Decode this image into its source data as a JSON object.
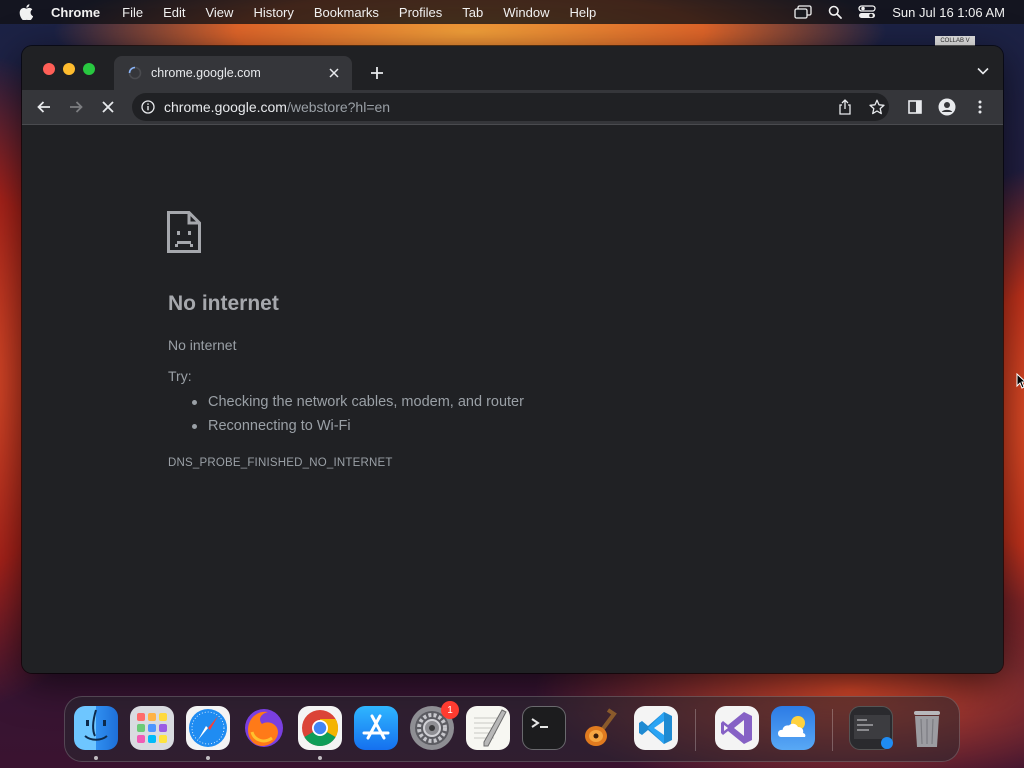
{
  "menubar": {
    "app_name": "Chrome",
    "items": [
      "File",
      "Edit",
      "View",
      "History",
      "Bookmarks",
      "Profiles",
      "Tab",
      "Window",
      "Help"
    ],
    "clock": "Sun Jul 16  1:06 AM"
  },
  "browser": {
    "tab": {
      "title": "chrome.google.com",
      "loading": true
    },
    "address": {
      "host": "chrome.google.com",
      "path": "/webstore?hl=en"
    }
  },
  "error_page": {
    "title": "No internet",
    "message": "No internet",
    "try_label": "Try:",
    "suggestions": [
      "Checking the network cables, modem, and router",
      "Reconnecting to Wi-Fi"
    ],
    "error_code": "DNS_PROBE_FINISHED_NO_INTERNET"
  },
  "dock": {
    "apps": [
      {
        "name": "Finder",
        "icon": "finder-icon",
        "running": true
      },
      {
        "name": "Launchpad",
        "icon": "launchpad-icon",
        "running": false
      },
      {
        "name": "Safari",
        "icon": "safari-icon",
        "running": true
      },
      {
        "name": "Firefox",
        "icon": "firefox-icon",
        "running": false
      },
      {
        "name": "Chrome",
        "icon": "chrome-icon",
        "running": true
      },
      {
        "name": "App Store",
        "icon": "app-store-icon",
        "running": false
      },
      {
        "name": "System Settings",
        "icon": "settings-icon",
        "running": false,
        "badge": "1"
      },
      {
        "name": "TextEdit",
        "icon": "textedit-icon",
        "running": false
      },
      {
        "name": "Terminal",
        "icon": "terminal-icon",
        "running": false
      },
      {
        "name": "GarageBand",
        "icon": "garageband-icon",
        "running": false
      },
      {
        "name": "Visual Studio Code",
        "icon": "vscode-icon",
        "running": false
      },
      {
        "name": "Visual Studio",
        "icon": "visual-studio-icon",
        "running": false
      },
      {
        "name": "Weather",
        "icon": "weather-icon",
        "running": false
      },
      {
        "name": "Screenshot",
        "icon": "screenshot-icon",
        "running": false
      },
      {
        "name": "Trash",
        "icon": "trash-icon",
        "running": false
      }
    ]
  },
  "colors": {
    "window_bg": "#202124",
    "toolbar_bg": "#35363a",
    "error_text": "#9aa0a6",
    "error_title": "#a6a8ad"
  }
}
